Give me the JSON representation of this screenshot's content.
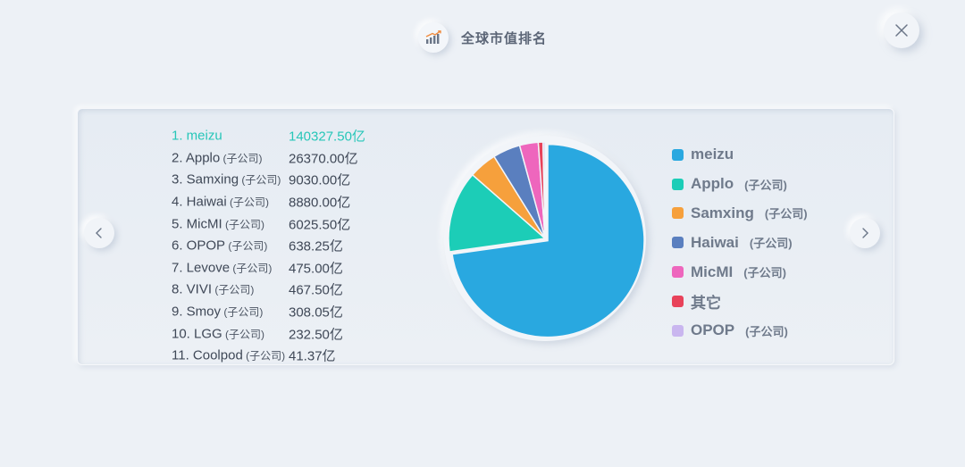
{
  "header": {
    "title": "全球市值排名",
    "icon": "bar-chart-rising-icon"
  },
  "controls": {
    "close_icon": "close-icon",
    "prev_icon": "chevron-left-icon",
    "next_icon": "chevron-right-icon"
  },
  "ranking": [
    {
      "name": "1. meizu",
      "suffix": "",
      "value": "140327.50亿",
      "active": true
    },
    {
      "name": "2. Applo",
      "suffix": "(子公司)",
      "value": "26370.00亿",
      "active": false
    },
    {
      "name": "3. Samxing",
      "suffix": "(子公司)",
      "value": "9030.00亿",
      "active": false
    },
    {
      "name": "4. Haiwai",
      "suffix": "(子公司)",
      "value": "8880.00亿",
      "active": false
    },
    {
      "name": "5. MicMI",
      "suffix": "(子公司)",
      "value": "6025.50亿",
      "active": false
    },
    {
      "name": "6. OPOP",
      "suffix": "(子公司)",
      "value": "638.25亿",
      "active": false
    },
    {
      "name": "7. Levove",
      "suffix": "(子公司)",
      "value": "475.00亿",
      "active": false
    },
    {
      "name": "8. VIVI",
      "suffix": "(子公司)",
      "value": "467.50亿",
      "active": false
    },
    {
      "name": "9. Smoy",
      "suffix": "(子公司)",
      "value": "308.05亿",
      "active": false
    },
    {
      "name": "10. LGG",
      "suffix": "(子公司)",
      "value": "232.50亿",
      "active": false
    },
    {
      "name": "11. Coolpod",
      "suffix": "(子公司)",
      "value": "41.37亿",
      "active": false
    }
  ],
  "legend": [
    {
      "label": "meizu",
      "suffix": "",
      "color": "#29a8e0"
    },
    {
      "label": "Applo",
      "suffix": "(子公司)",
      "color": "#1ccdb7"
    },
    {
      "label": "Samxing",
      "suffix": "(子公司)",
      "color": "#f6a03c"
    },
    {
      "label": "Haiwai",
      "suffix": "(子公司)",
      "color": "#5a7fbf"
    },
    {
      "label": "MicMI",
      "suffix": "(子公司)",
      "color": "#ee66bd"
    },
    {
      "label": "其它",
      "suffix": "",
      "color": "#e8425a"
    },
    {
      "label": "OPOP",
      "suffix": "(子公司)",
      "color": "#c9b6ef"
    }
  ],
  "chart_data": {
    "type": "pie",
    "categories": [
      "meizu",
      "Applo",
      "Samxing",
      "Haiwai",
      "MicMI",
      "其它",
      "OPOP"
    ],
    "values": [
      140327.5,
      26370.0,
      9030.0,
      8880.0,
      6025.5,
      1524.42,
      638.25
    ],
    "colors": [
      "#29a8e0",
      "#1ccdb7",
      "#f6a03c",
      "#5a7fbf",
      "#ee66bd",
      "#e8425a",
      "#c9b6ef"
    ],
    "exploded": "meizu",
    "legend_position": "right"
  }
}
